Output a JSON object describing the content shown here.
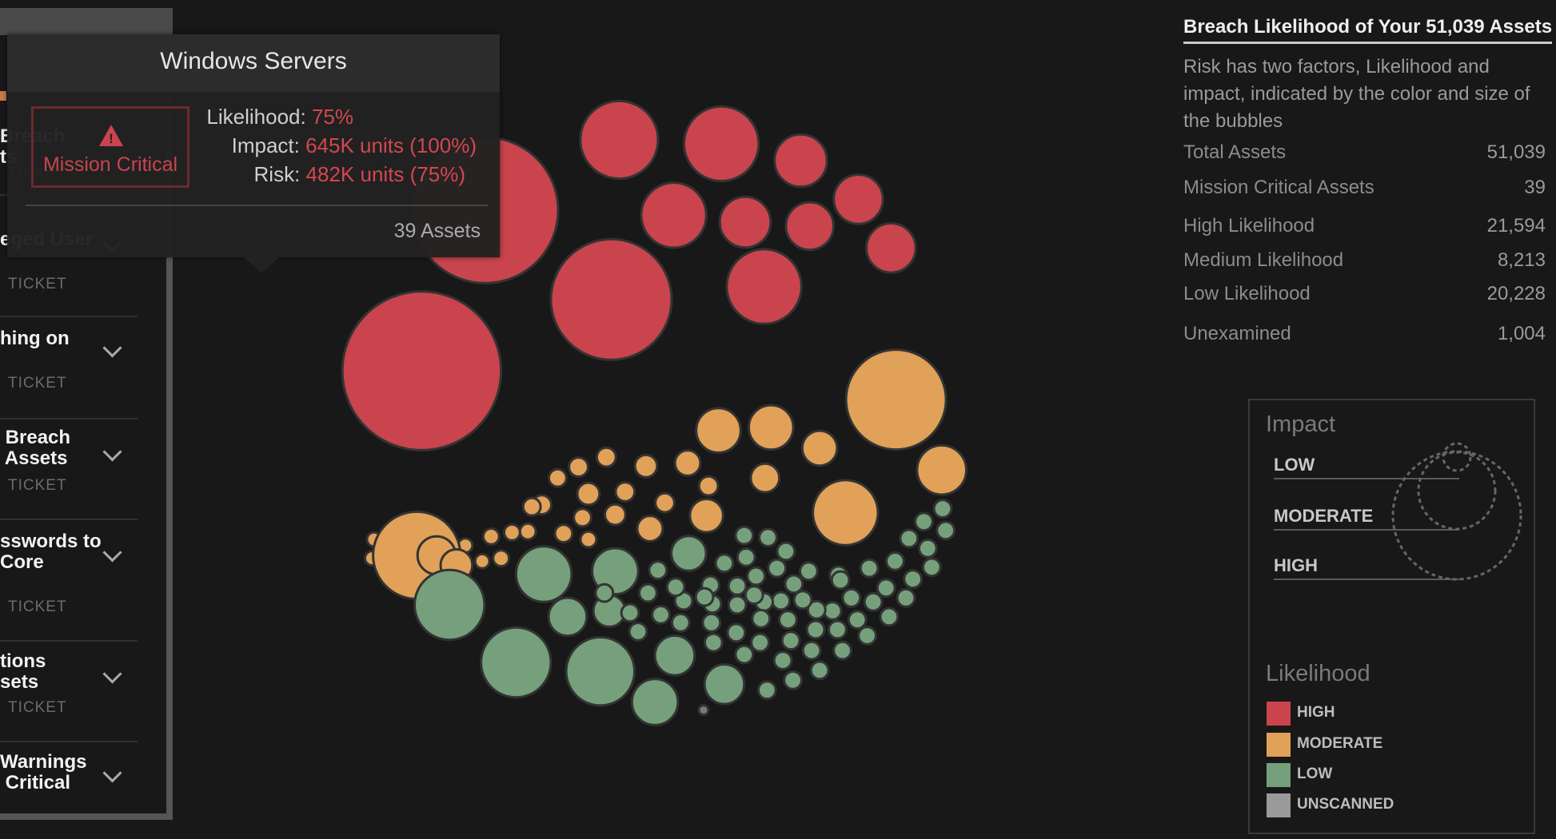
{
  "sidebar": {
    "items": [
      {
        "title": "Breach\nts",
        "ticket": "TICKET"
      },
      {
        "title": "eged User",
        "ticket": "TICKET"
      },
      {
        "title": "hing on",
        "ticket": "TICKET"
      },
      {
        "title": " Breach\n Assets",
        "ticket": "TICKET"
      },
      {
        "title": "sswords to\nCore",
        "ticket": "TICKET"
      },
      {
        "title": "tions\nsets",
        "ticket": "TICKET"
      },
      {
        "title": "Warnings\n Critical",
        "ticket": ""
      }
    ]
  },
  "tooltip": {
    "title": "Windows Servers",
    "badge": "Mission Critical",
    "likelihood_label": "Likelihood:",
    "likelihood_value": "75%",
    "impact_label": "Impact:",
    "impact_value": "645K units (100%)",
    "risk_label": "Risk:",
    "risk_value": "482K units (75%)",
    "assets": "39 Assets"
  },
  "panel": {
    "title": "Breach Likelihood of Your 51,039 Assets",
    "description": "Risk has two factors, Likelihood and impact, indicated by the color and size of the bubbles",
    "stats": [
      {
        "label": "Total Assets",
        "value": "51,039"
      },
      {
        "label": "Mission Critical Assets",
        "value": "39"
      },
      {
        "label": "High Likelihood",
        "value": "21,594"
      },
      {
        "label": "Medium Likelihood",
        "value": "8,213"
      },
      {
        "label": "Low Likelihood",
        "value": "20,228"
      },
      {
        "label": "Unexamined",
        "value": "1,004"
      }
    ]
  },
  "legend": {
    "impact_title": "Impact",
    "impact_levels": [
      "LOW",
      "MODERATE",
      "HIGH"
    ],
    "likelihood_title": "Likelihood",
    "likelihood_levels": [
      {
        "label": "HIGH",
        "color": "#c9444d"
      },
      {
        "label": "MODERATE",
        "color": "#e1a158"
      },
      {
        "label": "LOW",
        "color": "#75a07b"
      },
      {
        "label": "UNSCANNED",
        "color": "#9a9a9a"
      }
    ]
  },
  "chart_data": {
    "type": "scatter",
    "title": "Breach Likelihood of Your 51,039 Assets",
    "encoding": "color = likelihood class, size = relative impact (0-100)",
    "colors": {
      "high": "#c9444d",
      "moderate": "#e1a158",
      "low": "#75a07b",
      "unscanned": "#7a7a7a"
    },
    "bubbles": {
      "high": [
        100,
        92,
        76,
        49,
        47,
        33,
        41,
        32,
        30,
        31,
        31,
        47
      ],
      "moderate": [
        63,
        41,
        31,
        28,
        28,
        22,
        12,
        18,
        21,
        14,
        16,
        12,
        16,
        12,
        12,
        14,
        13,
        11,
        12,
        12,
        11,
        11,
        11,
        10,
        10,
        10,
        10,
        10,
        9,
        9,
        9,
        9,
        9,
        9,
        9,
        9,
        9,
        9,
        55,
        24,
        20
      ],
      "low": [
        44,
        44,
        43,
        35,
        29,
        29,
        25,
        25,
        24,
        22,
        20,
        11,
        11,
        11,
        11,
        11,
        11,
        11,
        11,
        11,
        11,
        11,
        11,
        11,
        11,
        11,
        11,
        11,
        11,
        11,
        11,
        11,
        11,
        11,
        11,
        11,
        11,
        11,
        11,
        11,
        11,
        11,
        11,
        11,
        11,
        11,
        11,
        11,
        11,
        11,
        11,
        11,
        11,
        11,
        11,
        11,
        11,
        11,
        11,
        11,
        11,
        11,
        11,
        11,
        11,
        11,
        11,
        11,
        11,
        11,
        11,
        11,
        11,
        11
      ],
      "unscanned": [
        6
      ]
    }
  }
}
